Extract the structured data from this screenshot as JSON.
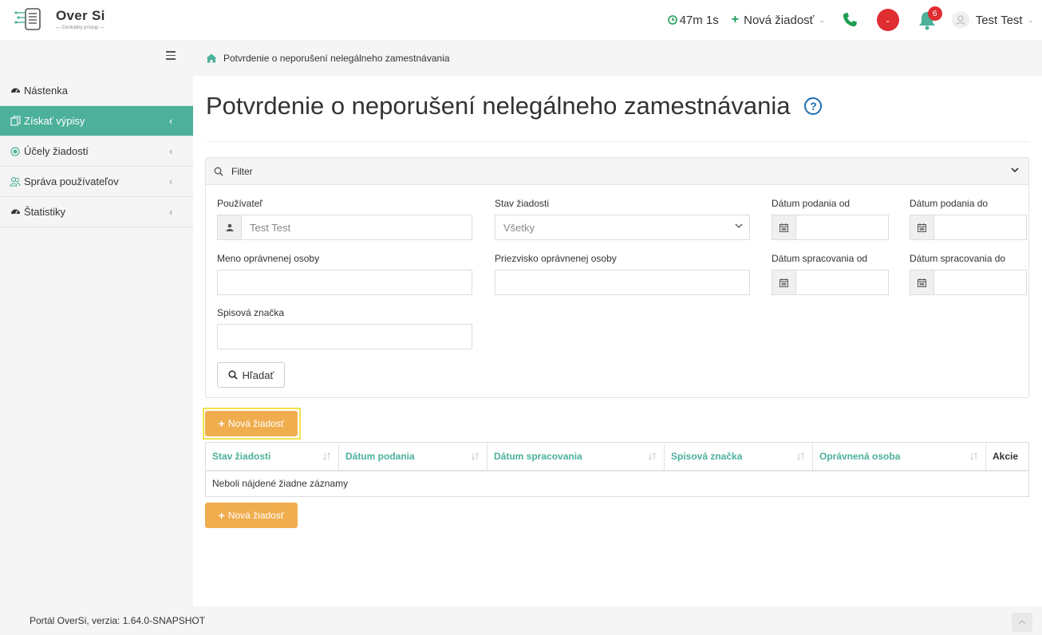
{
  "brand": {
    "name": "Over Si",
    "tagline": "— Centrálny prístup —"
  },
  "header": {
    "timer": "47m 1s",
    "new_request": "Nová žiadosť",
    "notifications_count": "6",
    "user_name": "Test Test"
  },
  "breadcrumb": {
    "label": "Potvrdenie o neporušení nelegálneho zamestnávania"
  },
  "sidebar": {
    "items": [
      {
        "label": "Nástenka",
        "icon": "dashboard-icon"
      },
      {
        "label": "Získať výpisy",
        "icon": "documents-icon",
        "active": true
      },
      {
        "label": "Účely žiadostí",
        "icon": "target-icon"
      },
      {
        "label": "Správa používateľov",
        "icon": "users-icon"
      },
      {
        "label": "Štatistiky",
        "icon": "dashboard-icon"
      }
    ]
  },
  "page": {
    "title": "Potvrdenie o neporušení nelegálneho zamestnávania"
  },
  "filter": {
    "title": "Filter",
    "user_label": "Používateľ",
    "user_value": "Test Test",
    "status_label": "Stav žiadosti",
    "status_value": "Všetky",
    "submitted_from_label": "Dátum podania od",
    "submitted_to_label": "Dátum podania do",
    "first_name_label": "Meno oprávnenej osoby",
    "last_name_label": "Priezvisko oprávnenej osoby",
    "processed_from_label": "Dátum spracovania od",
    "processed_to_label": "Dátum spracovania do",
    "file_no_label": "Spisová značka",
    "search_button": "Hľadať"
  },
  "actions": {
    "new_request_button": "Nová žiadosť"
  },
  "table": {
    "columns": [
      "Stav žiadosti",
      "Dátum podania",
      "Dátum spracovania",
      "Spisová značka",
      "Oprávnená osoba",
      "Akcie"
    ],
    "empty_message": "Neboli nájdené žiadne záznamy"
  },
  "footer": {
    "version": "Portál OverSi, verzia: 1.64.0-SNAPSHOT"
  },
  "colors": {
    "accent": "#4cb09a",
    "orange": "#f0ad4e",
    "danger": "#e02d32",
    "link_blue": "#1d6fb8"
  }
}
